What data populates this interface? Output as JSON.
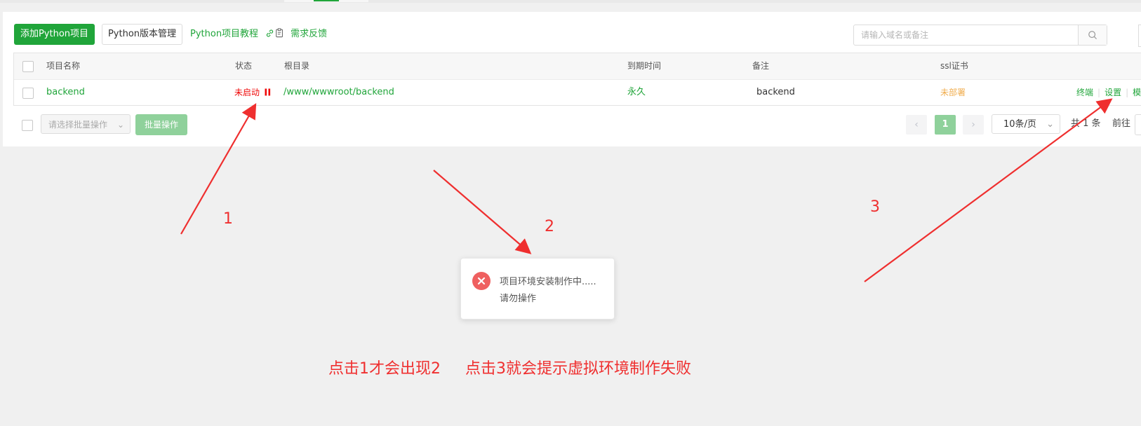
{
  "toolbar": {
    "add_project": "添加Python项目",
    "version_mgmt": "Python版本管理",
    "tutorial": "Python项目教程",
    "feedback": "需求反馈"
  },
  "search": {
    "placeholder": "请输入域名或备注"
  },
  "table": {
    "headers": {
      "name": "项目名称",
      "status": "状态",
      "root": "根目录",
      "expire": "到期时间",
      "remark": "备注",
      "ssl": "ssl证书"
    },
    "rows": [
      {
        "name": "backend",
        "status": "未启动",
        "root": "/www/wwwroot/backend",
        "expire": "永久",
        "remark": "backend",
        "ssl": "未部署",
        "actions": {
          "terminal": "终端",
          "settings": "设置",
          "more": "模"
        }
      }
    ]
  },
  "footer": {
    "batch_placeholder": "请选择批量操作",
    "batch_button": "批量操作",
    "current_page": "1",
    "page_size": "10条/页",
    "total": "共 1 条",
    "goto_label": "前往"
  },
  "toast": {
    "line1": "项目环境安装制作中.....",
    "line2": "请勿操作"
  },
  "annotations": {
    "num1": "1",
    "num2": "2",
    "num3": "3",
    "caption": "点击1才会出现2     点击3就会提示虚拟环境制作失败"
  },
  "colors": {
    "brand_green": "#20a53a",
    "status_red": "#ef0808",
    "ssl_orange": "#f0ad4e",
    "annotation_red": "#ef2f2f",
    "toast_error": "#ef6060"
  }
}
